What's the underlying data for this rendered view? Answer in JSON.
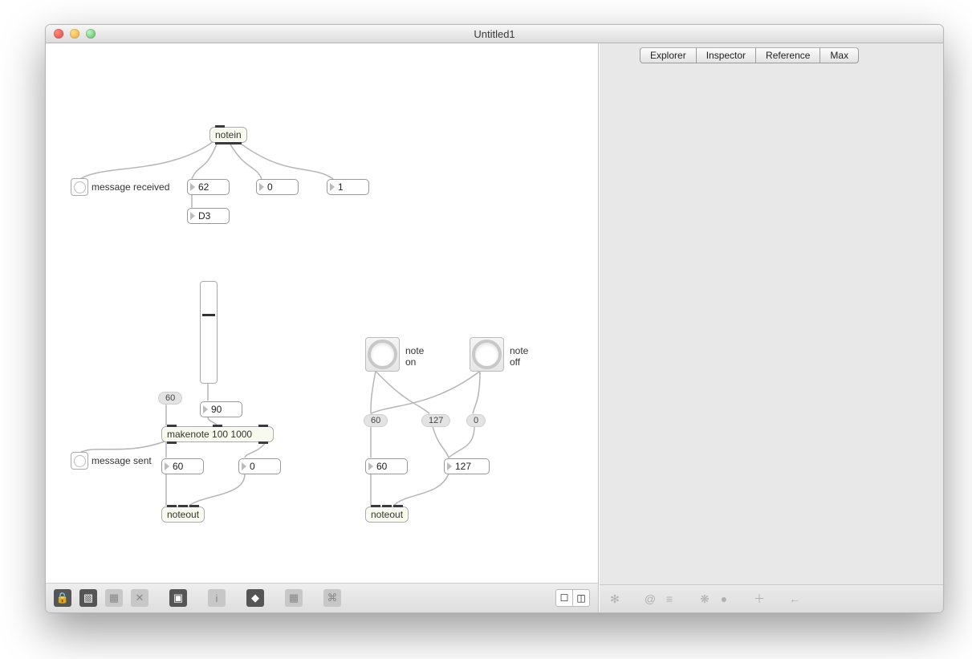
{
  "window_title": "Untitled1",
  "tabs": {
    "explorer": "Explorer",
    "inspector": "Inspector",
    "reference": "Reference",
    "max": "Max"
  },
  "notein": {
    "box": "notein",
    "comment_received": "message received",
    "pitch": "62",
    "velocity": "0",
    "channel": "1",
    "notename": "D3"
  },
  "slider_out": "90",
  "msg60": "60",
  "makenote": "makenote 100 1000",
  "comment_sent": "message sent",
  "sent_pitch": "60",
  "sent_velocity": "0",
  "noteout1": "noteout",
  "right": {
    "note_on_label": "note\non",
    "note_off_label": "note\noff",
    "msg_on_pitch": "60",
    "msg_on_vel": "127",
    "msg_off_vel": "0",
    "num_pitch": "60",
    "num_vel": "127",
    "noteout": "noteout"
  }
}
